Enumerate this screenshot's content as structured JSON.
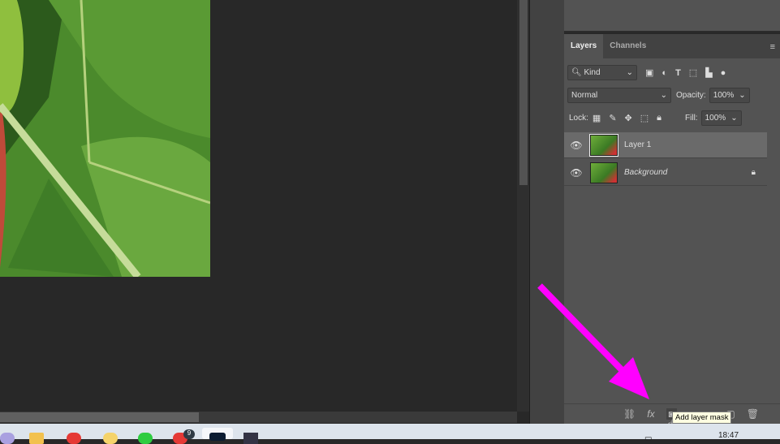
{
  "layers_panel": {
    "tabs": [
      {
        "label": "Layers",
        "active": true
      },
      {
        "label": "Channels",
        "active": false
      }
    ],
    "filter": {
      "label": "Kind"
    },
    "blend_mode": "Normal",
    "opacity_label": "Opacity:",
    "opacity": "100%",
    "lock_label": "Lock:",
    "fill_label": "Fill:",
    "fill": "100%",
    "layers": [
      {
        "name": "Layer 1",
        "selected": true,
        "visible": true,
        "locked": false
      },
      {
        "name": "Background",
        "selected": false,
        "visible": true,
        "locked": true
      }
    ]
  },
  "tooltip": "Add layer mask",
  "taskbar": {
    "clock": "18:47",
    "badge": "9"
  },
  "colors": {
    "annotation_arrow": "#ff00ff",
    "panel": "#535353",
    "canvas": "#282828"
  }
}
